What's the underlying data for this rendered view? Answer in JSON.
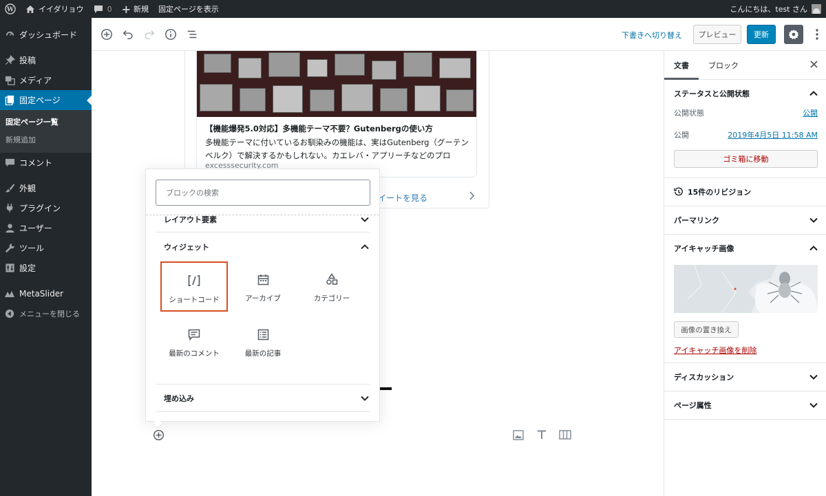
{
  "admin_bar": {
    "site_name": "イイダリョウ",
    "comments_count": "0",
    "new_label": "新規",
    "view_page": "固定ページを表示",
    "greeting": "こんにちは、test さん"
  },
  "sidebar": {
    "items": [
      {
        "label": "ダッシュボード",
        "icon": "gauge-icon"
      },
      {
        "label": "投稿",
        "icon": "pin-icon"
      },
      {
        "label": "メディア",
        "icon": "media-icon"
      },
      {
        "label": "固定ページ",
        "icon": "page-icon"
      },
      {
        "label": "コメント",
        "icon": "comment-icon"
      },
      {
        "label": "外観",
        "icon": "brush-icon"
      },
      {
        "label": "プラグイン",
        "icon": "plug-icon"
      },
      {
        "label": "ユーザー",
        "icon": "user-icon"
      },
      {
        "label": "ツール",
        "icon": "wrench-icon"
      },
      {
        "label": "設定",
        "icon": "settings-icon"
      },
      {
        "label": "MetaSlider",
        "icon": "metaslider-icon"
      },
      {
        "label": "メニューを閉じる",
        "icon": "collapse-icon"
      }
    ],
    "submenu": [
      "固定ページ一覧",
      "新規追加"
    ]
  },
  "toolbar": {
    "draft_link": "下書きへ切り替え",
    "preview": "プレビュー",
    "update": "更新"
  },
  "embed": {
    "title": "【機能爆発5.0対応】多機能テーマ不要？Gutenbergの使い方",
    "description": "多機能テーマに付いているお馴染みの機能は、実はGutenberg（グーテンベルク）で解決するかもしれない。カエレバ・アプリーチなどのプロ",
    "domain": "excesssecurity.com",
    "tweet_link": "イートを見る"
  },
  "inserter": {
    "search_placeholder": "ブロックの検索",
    "panels": {
      "layout": "レイアウト要素",
      "widgets": "ウィジェット",
      "embeds": "埋め込み"
    },
    "blocks": [
      {
        "label": "ショートコード",
        "icon": "shortcode-icon",
        "selected": true
      },
      {
        "label": "アーカイブ",
        "icon": "calendar-icon",
        "selected": false
      },
      {
        "label": "カテゴリー",
        "icon": "shapes-icon",
        "selected": false
      },
      {
        "label": "最新のコメント",
        "icon": "comment-icon",
        "selected": false
      },
      {
        "label": "最新の記事",
        "icon": "list-icon",
        "selected": false
      }
    ]
  },
  "settings": {
    "tabs": [
      "文書",
      "ブロック"
    ],
    "status": {
      "title": "ステータスと公開状態",
      "visibility_label": "公開状態",
      "visibility_value": "公開",
      "publish_label": "公開",
      "publish_value": "2019年4月5日 11:58 AM",
      "trash": "ゴミ箱に移動"
    },
    "revisions": "15件のリビジョン",
    "permalink": "パーマリンク",
    "featured": {
      "title": "アイキャッチ画像",
      "replace": "画像の置き換え",
      "remove": "アイキャッチ画像を削除"
    },
    "discussion": "ディスカッション",
    "page_attributes": "ページ属性"
  },
  "colors": {
    "admin_dark": "#23282d",
    "accent": "#0073aa",
    "update_button": "#0085ba",
    "selection": "#d54e21",
    "danger": "#aa0000"
  }
}
